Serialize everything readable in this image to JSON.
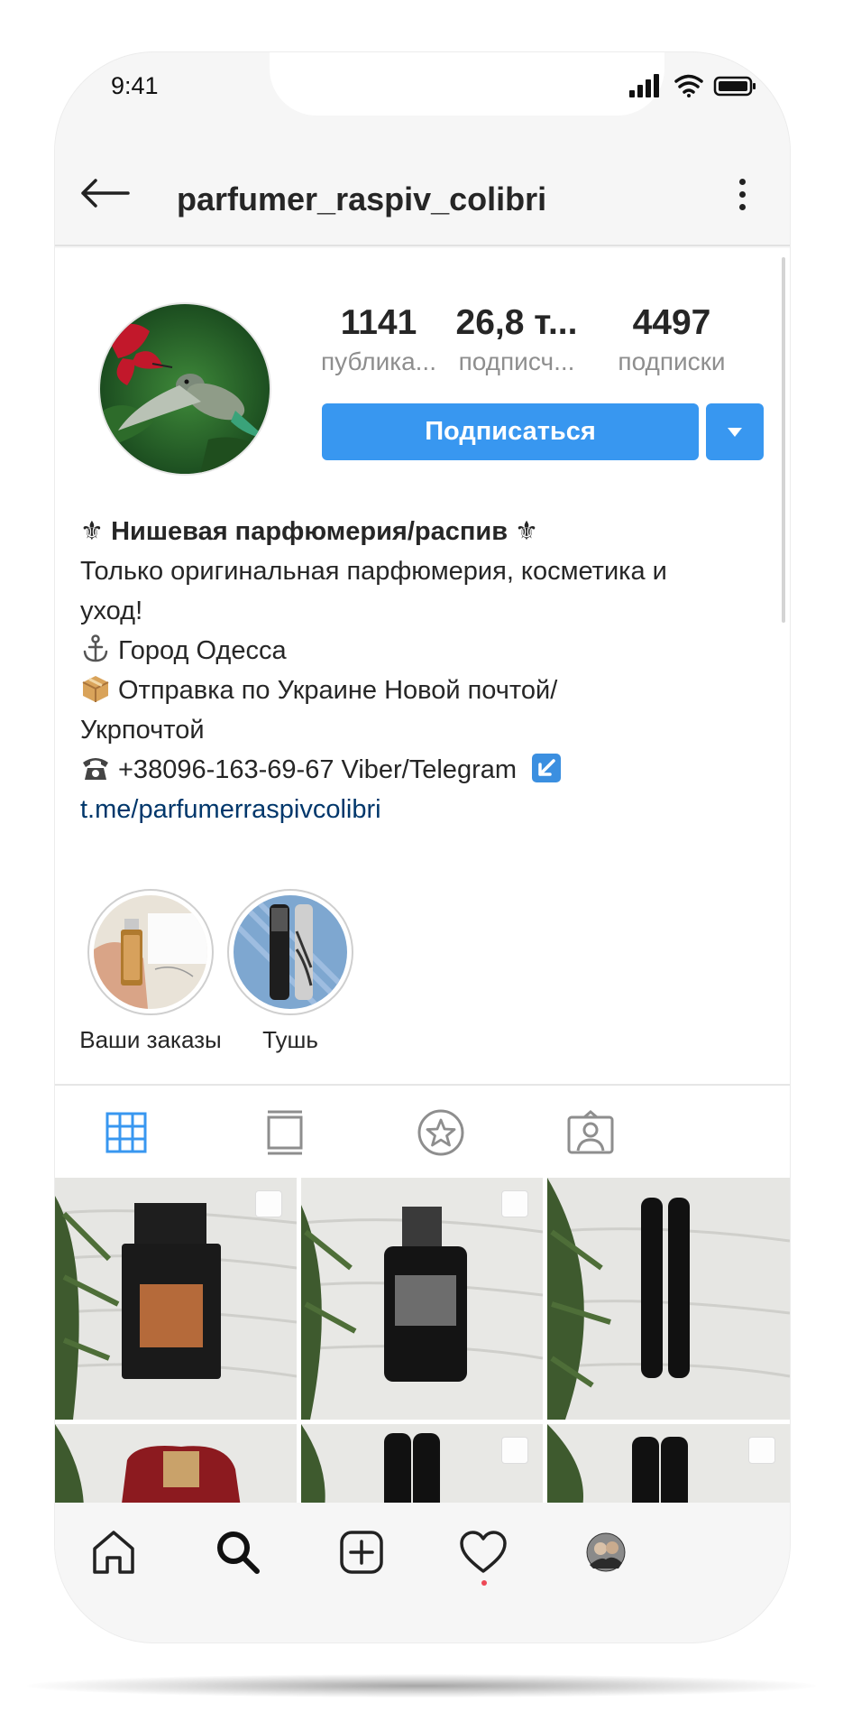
{
  "status_bar": {
    "time": "9:41",
    "icons": [
      "signal-icon",
      "wifi-icon",
      "battery-icon"
    ]
  },
  "header": {
    "username": "parfumer_raspiv_colibri",
    "back_icon": "arrow-left-icon",
    "menu_icon": "more-vertical-icon"
  },
  "profile": {
    "stats": [
      {
        "value": "1141",
        "label": "публика..."
      },
      {
        "value": "26,8 т...",
        "label": "подписч..."
      },
      {
        "value": "4497",
        "label": "подписки"
      }
    ],
    "follow_label": "Подписаться",
    "bio": {
      "title": "Нишевая парфюмерия/распив",
      "title_symbol": "⚜",
      "line1": "Только оригинальная парфюмерия, косметика и",
      "line2": "уход!",
      "city": "Город Одесса",
      "shipping_1": "Отправка по Украине Новой почтой/",
      "shipping_2": "Укрпочтой",
      "phone": "+38096-163-69-67 Viber/Telegram",
      "link": "t.me/parfumerraspivcolibri"
    }
  },
  "highlights": [
    {
      "label": "Ваши заказы"
    },
    {
      "label": "Тушь"
    }
  ],
  "tabs": [
    "grid-icon",
    "feed-icon",
    "star-icon",
    "tagged-icon"
  ],
  "nav": [
    "home-icon",
    "search-icon",
    "add-icon",
    "heart-icon",
    "profile-avatar"
  ],
  "colors": {
    "accent": "#3897f0",
    "link": "#00376b",
    "muted": "#8e8e8e",
    "text": "#262626"
  }
}
